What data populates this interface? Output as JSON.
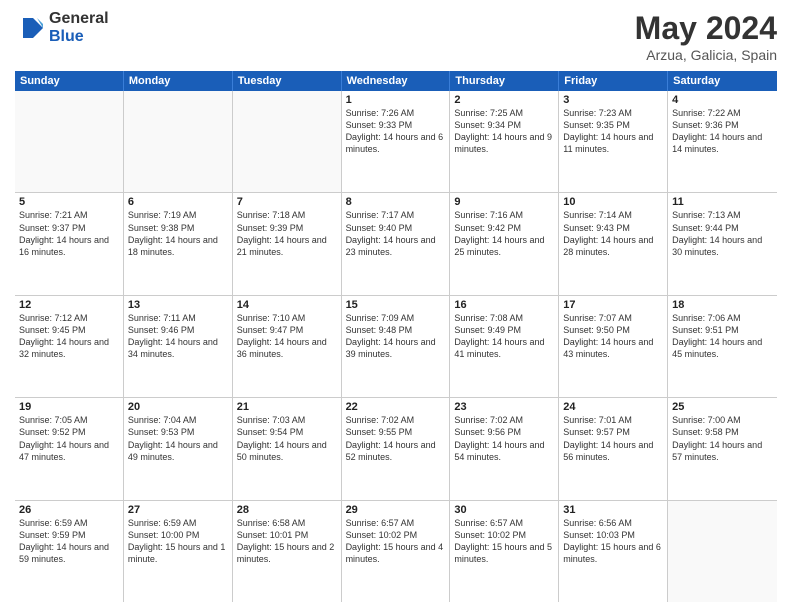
{
  "logo": {
    "general": "General",
    "blue": "Blue"
  },
  "title": "May 2024",
  "subtitle": "Arzua, Galicia, Spain",
  "headers": [
    "Sunday",
    "Monday",
    "Tuesday",
    "Wednesday",
    "Thursday",
    "Friday",
    "Saturday"
  ],
  "weeks": [
    [
      {
        "day": "",
        "empty": true
      },
      {
        "day": "",
        "empty": true
      },
      {
        "day": "",
        "empty": true
      },
      {
        "day": "1",
        "sunrise": "7:26 AM",
        "sunset": "9:33 PM",
        "daylight": "14 hours and 6 minutes."
      },
      {
        "day": "2",
        "sunrise": "7:25 AM",
        "sunset": "9:34 PM",
        "daylight": "14 hours and 9 minutes."
      },
      {
        "day": "3",
        "sunrise": "7:23 AM",
        "sunset": "9:35 PM",
        "daylight": "14 hours and 11 minutes."
      },
      {
        "day": "4",
        "sunrise": "7:22 AM",
        "sunset": "9:36 PM",
        "daylight": "14 hours and 14 minutes."
      }
    ],
    [
      {
        "day": "5",
        "sunrise": "7:21 AM",
        "sunset": "9:37 PM",
        "daylight": "14 hours and 16 minutes."
      },
      {
        "day": "6",
        "sunrise": "7:19 AM",
        "sunset": "9:38 PM",
        "daylight": "14 hours and 18 minutes."
      },
      {
        "day": "7",
        "sunrise": "7:18 AM",
        "sunset": "9:39 PM",
        "daylight": "14 hours and 21 minutes."
      },
      {
        "day": "8",
        "sunrise": "7:17 AM",
        "sunset": "9:40 PM",
        "daylight": "14 hours and 23 minutes."
      },
      {
        "day": "9",
        "sunrise": "7:16 AM",
        "sunset": "9:42 PM",
        "daylight": "14 hours and 25 minutes."
      },
      {
        "day": "10",
        "sunrise": "7:14 AM",
        "sunset": "9:43 PM",
        "daylight": "14 hours and 28 minutes."
      },
      {
        "day": "11",
        "sunrise": "7:13 AM",
        "sunset": "9:44 PM",
        "daylight": "14 hours and 30 minutes."
      }
    ],
    [
      {
        "day": "12",
        "sunrise": "7:12 AM",
        "sunset": "9:45 PM",
        "daylight": "14 hours and 32 minutes."
      },
      {
        "day": "13",
        "sunrise": "7:11 AM",
        "sunset": "9:46 PM",
        "daylight": "14 hours and 34 minutes."
      },
      {
        "day": "14",
        "sunrise": "7:10 AM",
        "sunset": "9:47 PM",
        "daylight": "14 hours and 36 minutes."
      },
      {
        "day": "15",
        "sunrise": "7:09 AM",
        "sunset": "9:48 PM",
        "daylight": "14 hours and 39 minutes."
      },
      {
        "day": "16",
        "sunrise": "7:08 AM",
        "sunset": "9:49 PM",
        "daylight": "14 hours and 41 minutes."
      },
      {
        "day": "17",
        "sunrise": "7:07 AM",
        "sunset": "9:50 PM",
        "daylight": "14 hours and 43 minutes."
      },
      {
        "day": "18",
        "sunrise": "7:06 AM",
        "sunset": "9:51 PM",
        "daylight": "14 hours and 45 minutes."
      }
    ],
    [
      {
        "day": "19",
        "sunrise": "7:05 AM",
        "sunset": "9:52 PM",
        "daylight": "14 hours and 47 minutes."
      },
      {
        "day": "20",
        "sunrise": "7:04 AM",
        "sunset": "9:53 PM",
        "daylight": "14 hours and 49 minutes."
      },
      {
        "day": "21",
        "sunrise": "7:03 AM",
        "sunset": "9:54 PM",
        "daylight": "14 hours and 50 minutes."
      },
      {
        "day": "22",
        "sunrise": "7:02 AM",
        "sunset": "9:55 PM",
        "daylight": "14 hours and 52 minutes."
      },
      {
        "day": "23",
        "sunrise": "7:02 AM",
        "sunset": "9:56 PM",
        "daylight": "14 hours and 54 minutes."
      },
      {
        "day": "24",
        "sunrise": "7:01 AM",
        "sunset": "9:57 PM",
        "daylight": "14 hours and 56 minutes."
      },
      {
        "day": "25",
        "sunrise": "7:00 AM",
        "sunset": "9:58 PM",
        "daylight": "14 hours and 57 minutes."
      }
    ],
    [
      {
        "day": "26",
        "sunrise": "6:59 AM",
        "sunset": "9:59 PM",
        "daylight": "14 hours and 59 minutes."
      },
      {
        "day": "27",
        "sunrise": "6:59 AM",
        "sunset": "10:00 PM",
        "daylight": "15 hours and 1 minute."
      },
      {
        "day": "28",
        "sunrise": "6:58 AM",
        "sunset": "10:01 PM",
        "daylight": "15 hours and 2 minutes."
      },
      {
        "day": "29",
        "sunrise": "6:57 AM",
        "sunset": "10:02 PM",
        "daylight": "15 hours and 4 minutes."
      },
      {
        "day": "30",
        "sunrise": "6:57 AM",
        "sunset": "10:02 PM",
        "daylight": "15 hours and 5 minutes."
      },
      {
        "day": "31",
        "sunrise": "6:56 AM",
        "sunset": "10:03 PM",
        "daylight": "15 hours and 6 minutes."
      },
      {
        "day": "",
        "empty": true
      }
    ]
  ]
}
